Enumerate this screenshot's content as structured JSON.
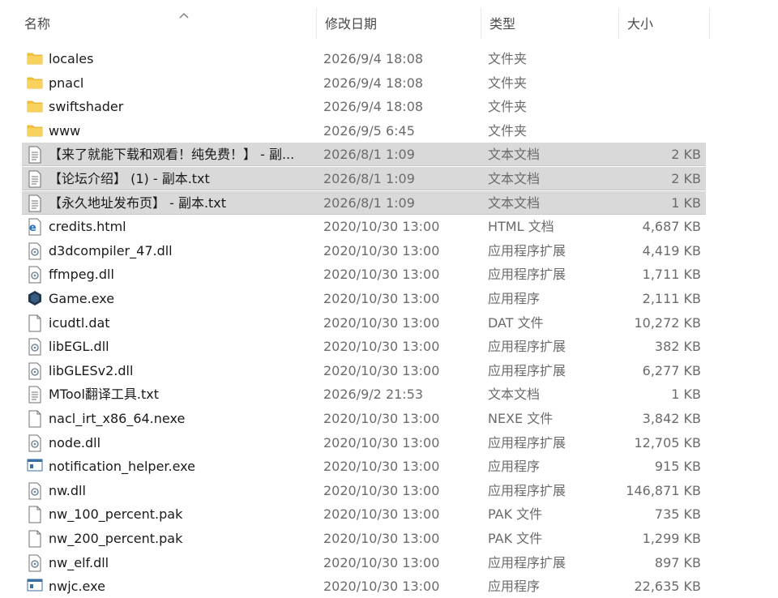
{
  "columns": {
    "name": "名称",
    "date": "修改日期",
    "type": "类型",
    "size": "大小"
  },
  "files": [
    {
      "icon": "folder-icon",
      "name": "locales",
      "date": "2026/9/4 18:08",
      "type": "文件夹",
      "size": "",
      "selected": false
    },
    {
      "icon": "folder-icon",
      "name": "pnacl",
      "date": "2026/9/4 18:08",
      "type": "文件夹",
      "size": "",
      "selected": false
    },
    {
      "icon": "folder-icon",
      "name": "swiftshader",
      "date": "2026/9/4 18:08",
      "type": "文件夹",
      "size": "",
      "selected": false
    },
    {
      "icon": "folder-icon",
      "name": "www",
      "date": "2026/9/5 6:45",
      "type": "文件夹",
      "size": "",
      "selected": false
    },
    {
      "icon": "text-document-icon",
      "name": "【来了就能下载和观看！纯免费！】 - 副...",
      "date": "2026/8/1 1:09",
      "type": "文本文档",
      "size": "2 KB",
      "selected": true
    },
    {
      "icon": "text-document-icon",
      "name": "【论坛介绍】 (1) - 副本.txt",
      "date": "2026/8/1 1:09",
      "type": "文本文档",
      "size": "2 KB",
      "selected": true
    },
    {
      "icon": "text-document-icon",
      "name": "【永久地址发布页】 - 副本.txt",
      "date": "2026/8/1 1:09",
      "type": "文本文档",
      "size": "1 KB",
      "selected": true
    },
    {
      "icon": "html-file-icon",
      "name": "credits.html",
      "date": "2020/10/30 13:00",
      "type": "HTML 文档",
      "size": "4,687 KB",
      "selected": false
    },
    {
      "icon": "dll-file-icon",
      "name": "d3dcompiler_47.dll",
      "date": "2020/10/30 13:00",
      "type": "应用程序扩展",
      "size": "4,419 KB",
      "selected": false
    },
    {
      "icon": "dll-file-icon",
      "name": "ffmpeg.dll",
      "date": "2020/10/30 13:00",
      "type": "应用程序扩展",
      "size": "1,711 KB",
      "selected": false
    },
    {
      "icon": "game-exe-icon",
      "name": "Game.exe",
      "date": "2020/10/30 13:00",
      "type": "应用程序",
      "size": "2,111 KB",
      "selected": false
    },
    {
      "icon": "blank-file-icon",
      "name": "icudtl.dat",
      "date": "2020/10/30 13:00",
      "type": "DAT 文件",
      "size": "10,272 KB",
      "selected": false
    },
    {
      "icon": "dll-file-icon",
      "name": "libEGL.dll",
      "date": "2020/10/30 13:00",
      "type": "应用程序扩展",
      "size": "382 KB",
      "selected": false
    },
    {
      "icon": "dll-file-icon",
      "name": "libGLESv2.dll",
      "date": "2020/10/30 13:00",
      "type": "应用程序扩展",
      "size": "6,277 KB",
      "selected": false
    },
    {
      "icon": "text-document-icon",
      "name": "MTool翻译工具.txt",
      "date": "2026/9/2 21:53",
      "type": "文本文档",
      "size": "1 KB",
      "selected": false
    },
    {
      "icon": "blank-file-icon",
      "name": "nacl_irt_x86_64.nexe",
      "date": "2020/10/30 13:00",
      "type": "NEXE 文件",
      "size": "3,842 KB",
      "selected": false
    },
    {
      "icon": "dll-file-icon",
      "name": "node.dll",
      "date": "2020/10/30 13:00",
      "type": "应用程序扩展",
      "size": "12,705 KB",
      "selected": false
    },
    {
      "icon": "exe-window-icon",
      "name": "notification_helper.exe",
      "date": "2020/10/30 13:00",
      "type": "应用程序",
      "size": "915 KB",
      "selected": false
    },
    {
      "icon": "dll-file-icon",
      "name": "nw.dll",
      "date": "2020/10/30 13:00",
      "type": "应用程序扩展",
      "size": "146,871 KB",
      "selected": false
    },
    {
      "icon": "blank-file-icon",
      "name": "nw_100_percent.pak",
      "date": "2020/10/30 13:00",
      "type": "PAK 文件",
      "size": "735 KB",
      "selected": false
    },
    {
      "icon": "blank-file-icon",
      "name": "nw_200_percent.pak",
      "date": "2020/10/30 13:00",
      "type": "PAK 文件",
      "size": "1,299 KB",
      "selected": false
    },
    {
      "icon": "dll-file-icon",
      "name": "nw_elf.dll",
      "date": "2020/10/30 13:00",
      "type": "应用程序扩展",
      "size": "897 KB",
      "selected": false
    },
    {
      "icon": "exe-window-icon",
      "name": "nwjc.exe",
      "date": "2020/10/30 13:00",
      "type": "应用程序",
      "size": "22,635 KB",
      "selected": false
    }
  ],
  "colors": {
    "selected_row": "#d9d9d9",
    "folder": "#f4c542",
    "secondary_text": "#6b6b6b"
  }
}
